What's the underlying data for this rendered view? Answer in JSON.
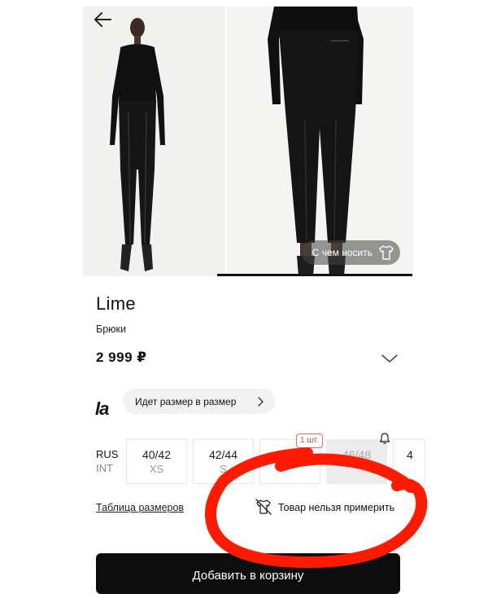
{
  "navigation": {
    "back_icon": "arrow-left-icon"
  },
  "gallery": {
    "wear_with_label": "С чем носить",
    "wear_with_icon": "tshirt-icon"
  },
  "product": {
    "brand": "Lime",
    "category": "Брюки",
    "price": "2 999 ₽",
    "expand_icon": "chevron-down-icon"
  },
  "fit": {
    "logo_text": "la",
    "message": "Идет размер в размер"
  },
  "sizes": {
    "system_rus": "RUS",
    "system_int": "INT",
    "items": [
      {
        "rus": "40/42",
        "int": "XS",
        "available": true
      },
      {
        "rus": "42/44",
        "int": "S",
        "available": true
      },
      {
        "rus": "44/46",
        "int": "",
        "available": true,
        "badge": "1 шт."
      },
      {
        "rus": "46/48",
        "int": "",
        "available": false,
        "notify_icon": "bell-icon"
      },
      {
        "rus": "4",
        "int": "",
        "available": true
      }
    ]
  },
  "links": {
    "size_table": "Таблица размеров",
    "no_tryon": "Товар нельзя примерить"
  },
  "cart": {
    "add_label": "Добавить в корзину"
  },
  "annotation": {
    "color": "#ff1a00"
  }
}
